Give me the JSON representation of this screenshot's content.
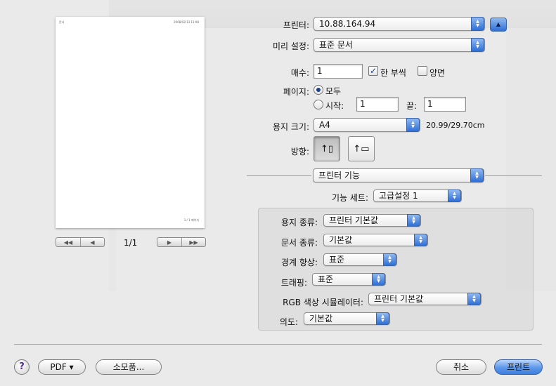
{
  "preview": {
    "header_left": "문서",
    "header_right": "2008/02/13 11:08",
    "footer": "1 / 1 페이지",
    "page_indicator": "1/1",
    "nav_first": "◀◀",
    "nav_prev": "◀",
    "nav_next": "▶",
    "nav_last": "▶▶"
  },
  "printer": {
    "label": "프린터:",
    "value": "10.88.164.94",
    "expand": "▲"
  },
  "presets": {
    "label": "미리 설정:",
    "value": "표준 문서"
  },
  "copies": {
    "label": "매수:",
    "value": "1",
    "collated_label": "한 부씩",
    "collated_checked": "✓",
    "duplex_label": "양면"
  },
  "pages": {
    "label": "페이지:",
    "all_label": "모두",
    "from_label": "시작:",
    "from_value": "1",
    "to_label": "끝:",
    "to_value": "1"
  },
  "paper_size": {
    "label": "용지 크기:",
    "value": "A4",
    "dims": "20.99/29.70cm"
  },
  "orientation": {
    "label": "방향:"
  },
  "panel": {
    "value": "프린터 기능"
  },
  "feature_set": {
    "label": "기능 세트:",
    "value": "고급설정 1"
  },
  "features": {
    "paper_type": {
      "label": "용지 종류:",
      "value": "프린터 기본값"
    },
    "doc_type": {
      "label": "문서 종류:",
      "value": "기본값"
    },
    "edge": {
      "label": "경계 향상:",
      "value": "표준"
    },
    "trapping": {
      "label": "트래핑:",
      "value": "표준"
    },
    "rgb": {
      "label": "RGB 색상 시뮬레이터:",
      "value": "프린터 기본값"
    },
    "intent": {
      "label": "의도:",
      "value": "기본값"
    }
  },
  "buttons": {
    "help": "?",
    "pdf": "PDF ▾",
    "supplies": "소모품...",
    "cancel": "취소",
    "print": "프린트"
  },
  "colors": {
    "accent": "#3e7fdd"
  }
}
